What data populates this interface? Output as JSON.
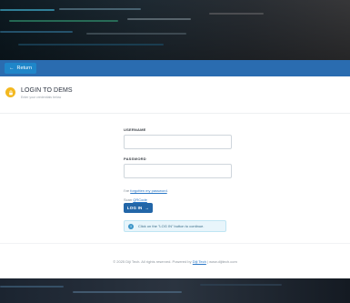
{
  "nav": {
    "return_label": "Return"
  },
  "header": {
    "title": "LOGIN TO DEMS",
    "subtitle": "Enter your credentials below"
  },
  "form": {
    "username_label": "USERNAME",
    "username_value": "",
    "password_label": "PASSWORD",
    "password_value": "",
    "forgot_prefix": "I've",
    "forgot_link": "forgotten my password",
    "forgot_suffix": ".",
    "scan_prefix": "Scan",
    "scan_link": "QRCode",
    "login_label": "LOG IN"
  },
  "info": {
    "message": "Click on the \"LOG IN\" button to continue."
  },
  "footer": {
    "prefix": "© 2025 Diji Tech. All rights reserved. Powered by",
    "link": "Diji Tech",
    "suffix": "| www.dijitech.com"
  },
  "colors": {
    "nav_bar": "#2a6cb0",
    "return_button": "#1f86c9",
    "badge": "#f3b81f",
    "login_button": "#2266a8",
    "info_bg": "#e8f5fb",
    "link": "#2b78c6"
  },
  "icons": {
    "return": "arrow-left-icon",
    "header": "lock-icon",
    "login": "arrow-right-icon",
    "info": "info-icon"
  }
}
